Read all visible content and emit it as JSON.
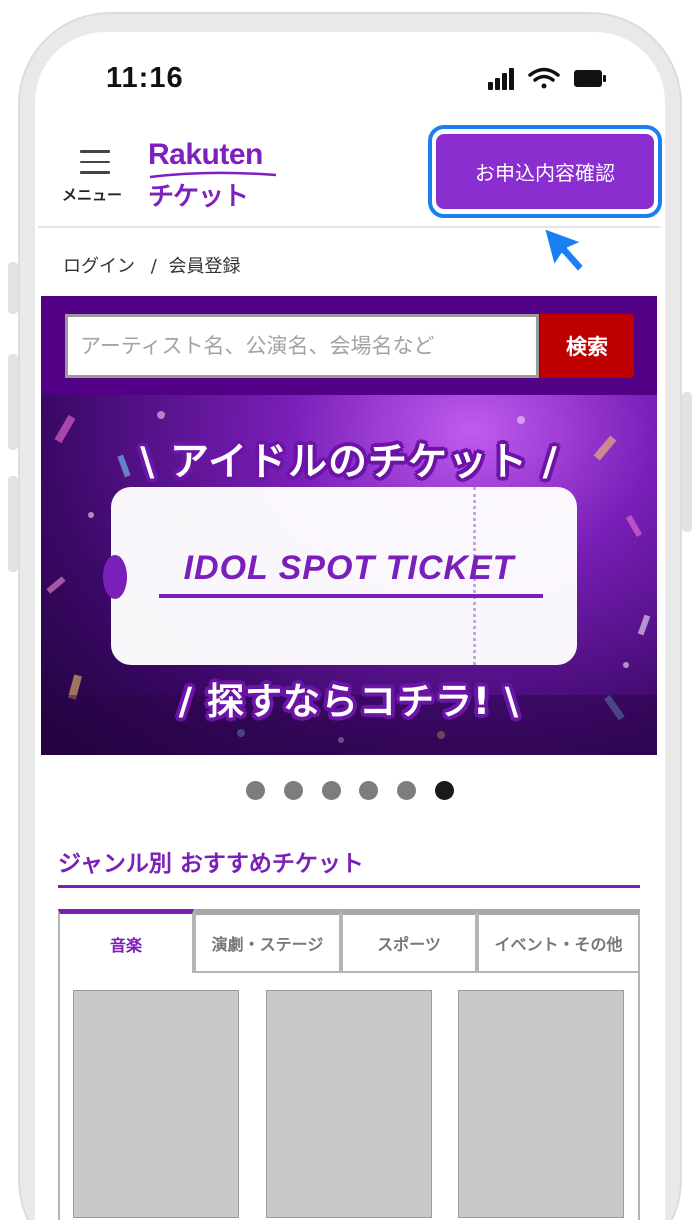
{
  "status_bar": {
    "time": "11:16",
    "icons": [
      "signal-icon",
      "wifi-icon",
      "battery-icon"
    ]
  },
  "header": {
    "menu_label": "メニュー",
    "logo_en": "Rakuten",
    "logo_jp": "チケット",
    "apply_button": "お申込内容確認"
  },
  "auth": {
    "login": "ログイン",
    "separator": "/",
    "register": "会員登録"
  },
  "search": {
    "placeholder": "アーティスト名、公演名、会場名など",
    "button": "検索"
  },
  "banner": {
    "top_text": "\\ アイドルのチケット /",
    "title": "IDOL SPOT TICKET",
    "bottom_text": "/ 探すならコチラ! \\",
    "slide_count": 6,
    "active_slide": 6
  },
  "section": {
    "title": "ジャンル別 おすすめチケット",
    "tabs": [
      "音楽",
      "演劇・ステージ",
      "スポーツ",
      "イベント・その他"
    ],
    "active_tab": 0
  },
  "colors": {
    "brand_purple": "#7a1fb8",
    "apply_button": "#8a2ed0",
    "highlight_blue": "#1a7ff0",
    "search_band": "#520085",
    "search_button": "#bf0000"
  }
}
